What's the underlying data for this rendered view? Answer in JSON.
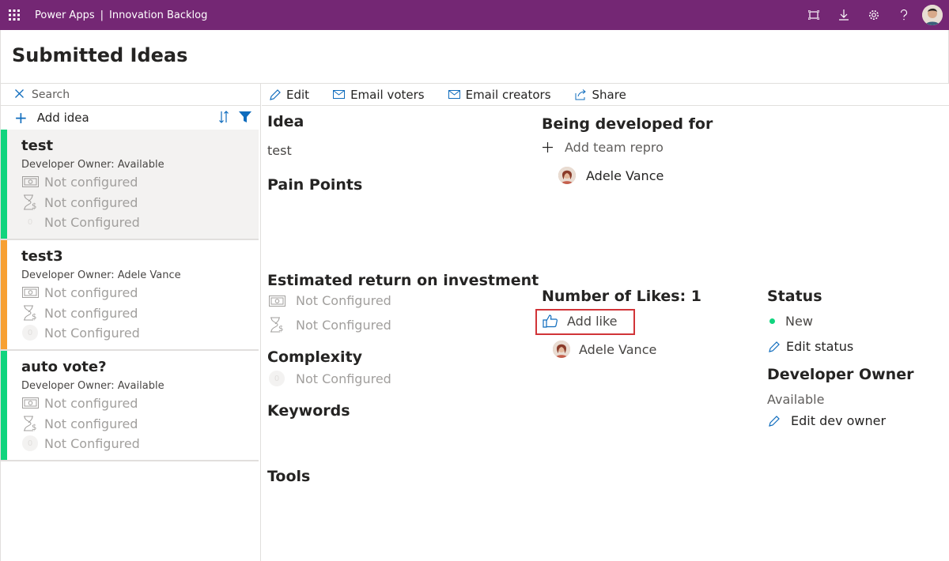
{
  "header": {
    "app_name": "Power Apps",
    "separator": "|",
    "app_title": "Innovation Backlog",
    "bg_color": "#742774"
  },
  "page": {
    "title": "Submitted Ideas"
  },
  "left": {
    "search_placeholder": "Search",
    "add_idea_label": "Add idea",
    "ideas": [
      {
        "name": "test",
        "owner": "Developer Owner: Available",
        "metric1": "Not configured",
        "metric2": "Not configured",
        "metric3": "Not Configured",
        "stripe_color": "#10d47e",
        "zero": "0"
      },
      {
        "name": "test3",
        "owner": "Developer Owner: Adele Vance",
        "metric1": "Not configured",
        "metric2": "Not configured",
        "metric3": "Not Configured",
        "stripe_color": "#f7a032",
        "zero": "0"
      },
      {
        "name": "auto vote?",
        "owner": "Developer Owner: Available",
        "metric1": "Not configured",
        "metric2": "Not configured",
        "metric3": "Not Configured",
        "stripe_color": "#10d47e",
        "zero": "0"
      }
    ]
  },
  "toolbar": {
    "edit": "Edit",
    "email_voters": "Email voters",
    "email_creators": "Email creators",
    "share": "Share"
  },
  "detail": {
    "idea_label": "Idea",
    "idea_value": "test",
    "pain_points_label": "Pain Points",
    "roi_label": "Estimated return on investment",
    "roi_value1": "Not Configured",
    "roi_value2": "Not Configured",
    "complexity_label": "Complexity",
    "complexity_value": "Not Configured",
    "complexity_zero": "0",
    "keywords_label": "Keywords",
    "tools_label": "Tools",
    "developed_for_label": "Being developed for",
    "add_team_repro": "Add team repro",
    "developed_for_person": "Adele Vance",
    "likes_label": "Number of Likes: 1",
    "add_like": "Add like",
    "like_person": "Adele Vance",
    "status_label": "Status",
    "status_value": "New",
    "status_dot_color": "#10d47e",
    "edit_status": "Edit status",
    "dev_owner_label": "Developer Owner",
    "dev_owner_value": "Available",
    "edit_dev_owner": "Edit dev owner"
  }
}
